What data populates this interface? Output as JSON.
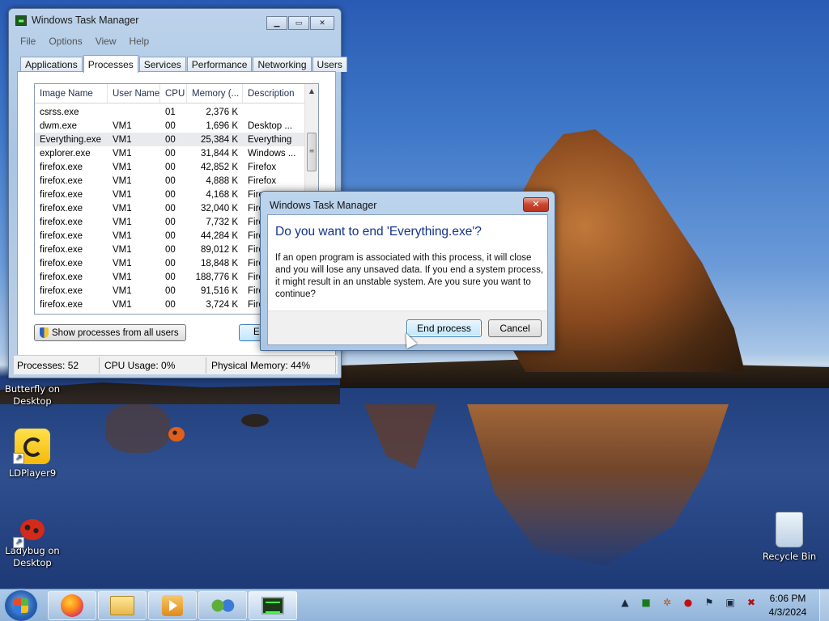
{
  "desktop": {
    "icons": [
      {
        "label": "Butterfly on Desktop"
      },
      {
        "label": "LDPlayer9"
      },
      {
        "label": "Ladybug on Desktop"
      },
      {
        "label": "Recycle Bin"
      }
    ]
  },
  "taskmanager": {
    "title": "Windows Task Manager",
    "menu": [
      "File",
      "Options",
      "View",
      "Help"
    ],
    "tabs": [
      "Applications",
      "Processes",
      "Services",
      "Performance",
      "Networking",
      "Users"
    ],
    "active_tab": "Processes",
    "columns": [
      "Image Name",
      "User Name",
      "CPU",
      "Memory (...",
      "Description"
    ],
    "rows": [
      {
        "name": "csrss.exe",
        "user": "",
        "cpu": "01",
        "mem": "2,376 K",
        "desc": ""
      },
      {
        "name": "dwm.exe",
        "user": "VM1",
        "cpu": "00",
        "mem": "1,696 K",
        "desc": "Desktop ..."
      },
      {
        "name": "Everything.exe",
        "user": "VM1",
        "cpu": "00",
        "mem": "25,384 K",
        "desc": "Everything"
      },
      {
        "name": "explorer.exe",
        "user": "VM1",
        "cpu": "00",
        "mem": "31,844 K",
        "desc": "Windows ..."
      },
      {
        "name": "firefox.exe",
        "user": "VM1",
        "cpu": "00",
        "mem": "42,852 K",
        "desc": "Firefox"
      },
      {
        "name": "firefox.exe",
        "user": "VM1",
        "cpu": "00",
        "mem": "4,888 K",
        "desc": "Firefox"
      },
      {
        "name": "firefox.exe",
        "user": "VM1",
        "cpu": "00",
        "mem": "4,168 K",
        "desc": "Fire"
      },
      {
        "name": "firefox.exe",
        "user": "VM1",
        "cpu": "00",
        "mem": "32,040 K",
        "desc": "Fire"
      },
      {
        "name": "firefox.exe",
        "user": "VM1",
        "cpu": "00",
        "mem": "7,732 K",
        "desc": "Fire"
      },
      {
        "name": "firefox.exe",
        "user": "VM1",
        "cpu": "00",
        "mem": "44,284 K",
        "desc": "Fire"
      },
      {
        "name": "firefox.exe",
        "user": "VM1",
        "cpu": "00",
        "mem": "89,012 K",
        "desc": "Fire"
      },
      {
        "name": "firefox.exe",
        "user": "VM1",
        "cpu": "00",
        "mem": "18,848 K",
        "desc": "Fire"
      },
      {
        "name": "firefox.exe",
        "user": "VM1",
        "cpu": "00",
        "mem": "188,776 K",
        "desc": "Fire"
      },
      {
        "name": "firefox.exe",
        "user": "VM1",
        "cpu": "00",
        "mem": "91,516 K",
        "desc": "Fire"
      },
      {
        "name": "firefox.exe",
        "user": "VM1",
        "cpu": "00",
        "mem": "3,724 K",
        "desc": "Fire"
      }
    ],
    "selected_row_index": 2,
    "show_all_label": "Show processes from all users",
    "end_button_partial": "E",
    "status": {
      "processes": "Processes: 52",
      "cpu": "CPU Usage: 0%",
      "memory": "Physical Memory: 44%"
    }
  },
  "dialog": {
    "title": "Windows Task Manager",
    "heading": "Do you want to end 'Everything.exe'?",
    "message": "If an open program is associated with this process, it will close and you will lose any unsaved data. If you end a system process, it might result in an unstable system. Are you sure you want to continue?",
    "confirm_label": "End process",
    "cancel_label": "Cancel"
  },
  "taskbar": {
    "pinned": [
      "firefox-icon",
      "windows-explorer-icon",
      "media-player-icon",
      "network-icon",
      "task-manager-icon"
    ],
    "clock": {
      "time": "6:06 PM",
      "date": "4/3/2024"
    }
  }
}
